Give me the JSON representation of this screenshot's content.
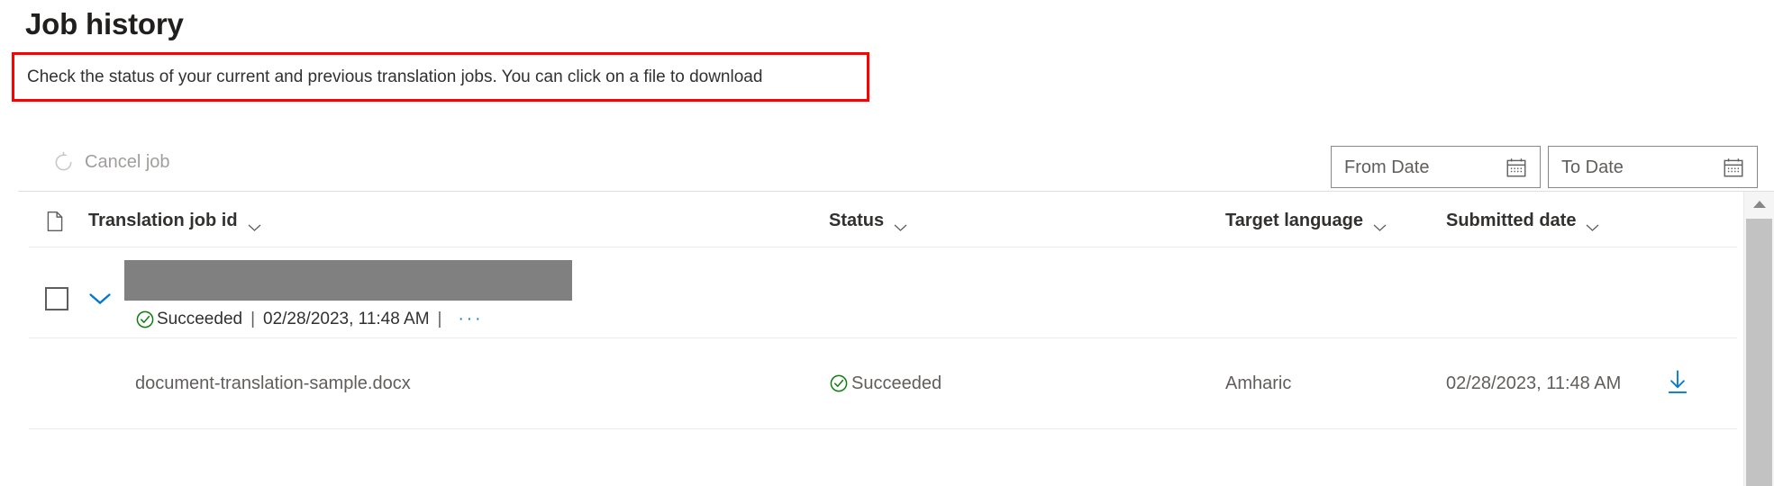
{
  "header": {
    "title": "Job history",
    "description": "Check the status of your current and previous translation jobs. You can click on a file to download",
    "highlight_color": "#ff0000"
  },
  "command_bar": {
    "cancel_job": {
      "label": "Cancel job",
      "icon": "cancel-circular-arrow-icon",
      "disabled": true
    },
    "from_date": {
      "placeholder": "From Date",
      "value": "",
      "icon": "calendar-icon"
    },
    "to_date": {
      "placeholder": "To Date",
      "value": "",
      "icon": "calendar-icon"
    }
  },
  "table": {
    "columns": [
      {
        "key": "job_id",
        "label": "Translation job id",
        "sortable": true
      },
      {
        "key": "status",
        "label": "Status",
        "sortable": true
      },
      {
        "key": "target_language",
        "label": "Target language",
        "sortable": true
      },
      {
        "key": "submitted_date",
        "label": "Submitted date",
        "sortable": true
      }
    ],
    "row_icon": "document-icon",
    "rows": [
      {
        "type": "job",
        "selected": false,
        "expanded": true,
        "job_id_redacted": true,
        "status": "Succeeded",
        "submitted_date": "02/28/2023, 11:48 AM",
        "separator": "|",
        "overflow_label": "···",
        "children": [
          {
            "type": "file",
            "file_name": "document-translation-sample.docx",
            "status": "Succeeded",
            "target_language": "Amharic",
            "submitted_date": "02/28/2023, 11:48 AM",
            "download_icon": "download-icon"
          }
        ]
      }
    ]
  },
  "scrollbar": {
    "up_arrow": "scroll-up-arrow-icon",
    "orientation": "vertical"
  },
  "colors": {
    "success": "#107c10",
    "accent": "#0078d4",
    "redaction": "#808080",
    "disabled_text": "#a19f9d",
    "border": "#8a8886"
  }
}
